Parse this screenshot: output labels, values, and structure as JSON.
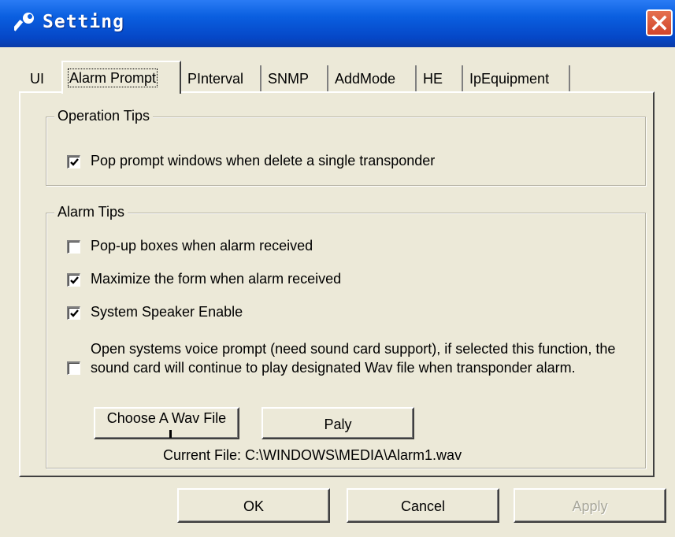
{
  "window": {
    "title": "Setting",
    "title_icon": "wrench-icon",
    "close_icon": "close-icon"
  },
  "tabs": [
    {
      "label": "UI",
      "active": false
    },
    {
      "label": "Alarm Prompt",
      "active": true
    },
    {
      "label": "PInterval",
      "active": false
    },
    {
      "label": "SNMP",
      "active": false
    },
    {
      "label": "AddMode",
      "active": false
    },
    {
      "label": "HE",
      "active": false
    },
    {
      "label": "IpEquipment",
      "active": false
    }
  ],
  "operation_tips": {
    "legend": "Operation Tips",
    "items": [
      {
        "label": "Pop prompt windows when delete a single transponder",
        "checked": true
      }
    ]
  },
  "alarm_tips": {
    "legend": "Alarm Tips",
    "items": [
      {
        "label": "Pop-up boxes when alarm received",
        "checked": false
      },
      {
        "label": "Maximize the form when alarm received",
        "checked": true
      },
      {
        "label": "System Speaker Enable",
        "checked": true
      },
      {
        "label": "Open systems voice prompt (need sound card support), if selected this function, the sound card will continue to play designated Wav file when transponder alarm.",
        "checked": false
      }
    ],
    "choose_wav_label": "Choose A Wav File",
    "play_label": "Paly",
    "current_file_label": "Current File:",
    "current_file_value": "C:\\WINDOWS\\MEDIA\\Alarm1.wav"
  },
  "footer": {
    "ok_label": "OK",
    "cancel_label": "Cancel",
    "apply_label": "Apply",
    "apply_enabled": false
  },
  "colors": {
    "titlebar": "#0a5fe0",
    "close_button": "#d0442a",
    "background": "#ece9d8"
  }
}
